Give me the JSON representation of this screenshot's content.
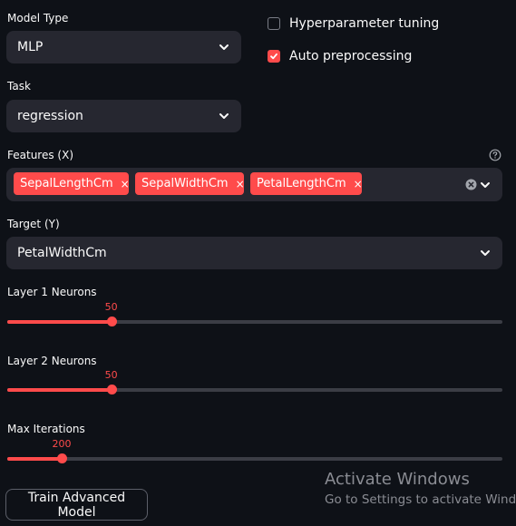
{
  "model_type": {
    "label": "Model Type",
    "value": "MLP"
  },
  "options": {
    "hyperparameter": {
      "label": "Hyperparameter tuning",
      "checked": false
    },
    "auto_preprocessing": {
      "label": "Auto preprocessing",
      "checked": true
    }
  },
  "task": {
    "label": "Task",
    "value": "regression"
  },
  "features": {
    "label": "Features (X)",
    "help_icon": "help-circle-icon",
    "chips": [
      "SepalLengthCm",
      "SepalWidthCm",
      "PetalLengthCm"
    ],
    "remove_glyph": "×"
  },
  "target": {
    "label": "Target (Y)",
    "value": "PetalWidthCm"
  },
  "layer1": {
    "label": "Layer 1 Neurons",
    "value": "50",
    "fraction": 0.21
  },
  "layer2": {
    "label": "Layer 2 Neurons",
    "value": "50",
    "fraction": 0.21
  },
  "max_iter": {
    "label": "Max Iterations",
    "value": "200",
    "fraction": 0.11
  },
  "train_button": {
    "label": "Train Advanced Model"
  },
  "watermark": {
    "line1": "Activate Windows",
    "line2": "Go to Settings to activate Windo"
  },
  "colors": {
    "accent": "#ff4b4b",
    "background": "#0e1117",
    "input": "#262730"
  }
}
